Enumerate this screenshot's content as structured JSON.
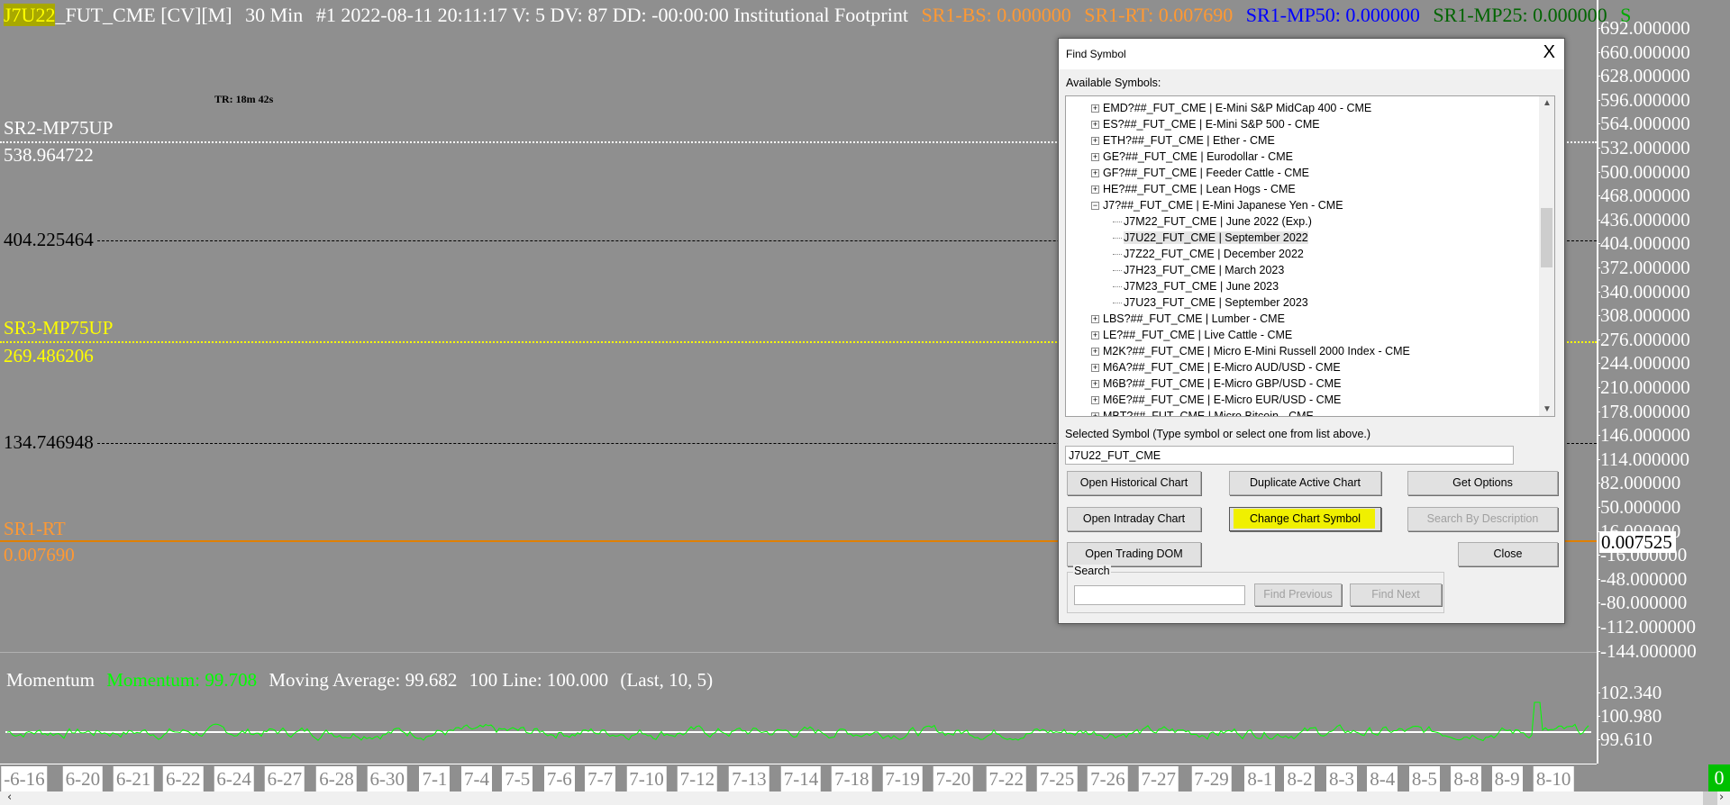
{
  "chart_header": {
    "symbol_highlight": "J7U22",
    "symbol_rest": "_FUT_CME [CV][M]",
    "interval": "30 Min",
    "info": "#1 2022-08-11 20:11:17 V: 5 DV: 87 DD: -00:00:00 Institutional Footprint",
    "sr1_bs": "SR1-BS: 0.000000",
    "sr1_rt": "SR1-RT: 0.007690",
    "sr1_mp50": "SR1-MP50: 0.000000",
    "sr1_mp25": "SR1-MP25: 0.000000",
    "trailing": "S"
  },
  "timer": "TR: 18m 42s",
  "levels": [
    {
      "name": "SR2-MP75UP",
      "value": "538.964722",
      "color": "#ffffff"
    },
    {
      "name": "",
      "value": "404.225464",
      "color": "#000000"
    },
    {
      "name": "SR3-MP75UP",
      "value": "269.486206",
      "color": "#ffff00"
    },
    {
      "name": "",
      "value": "134.746948",
      "color": "#000000"
    },
    {
      "name": "SR1-RT",
      "value": "0.007690",
      "color": "#ff8c32"
    }
  ],
  "price_axis": [
    "692.000000",
    "660.000000",
    "628.000000",
    "596.000000",
    "564.000000",
    "532.000000",
    "500.000000",
    "468.000000",
    "436.000000",
    "404.000000",
    "372.000000",
    "340.000000",
    "308.000000",
    "276.000000",
    "244.000000",
    "210.000000",
    "178.000000",
    "146.000000",
    "114.000000",
    "82.000000",
    "50.000000",
    "16.000000",
    "-16.000000",
    "-48.000000",
    "-80.000000",
    "-112.000000",
    "-144.000000"
  ],
  "current_price": "0.007525",
  "momentum": {
    "title": "Momentum",
    "value_label": "Momentum: 99.708",
    "ma_label": "Moving Average: 99.682",
    "line_label": "100 Line: 100.000",
    "params": "(Last, 10, 5)",
    "axis": [
      "102.340",
      "100.980",
      "99.610"
    ],
    "color": "#00ff00"
  },
  "dates": [
    "-6-16",
    "6-20",
    "6-21",
    "6-22",
    "6-24",
    "6-27",
    "6-28",
    "6-30",
    "7-1",
    "7-4",
    "7-5",
    "7-6",
    "7-7",
    "7-10",
    "7-12",
    "7-13",
    "7-14",
    "7-18",
    "7-19",
    "7-20",
    "7-22",
    "7-25",
    "7-26",
    "7-27",
    "7-29",
    "8-1",
    "8-2",
    "8-3",
    "8-4",
    "8-5",
    "8-8",
    "8-9",
    "8-10"
  ],
  "zero_badge": "0",
  "dialog": {
    "title": "Find Symbol",
    "close": "X",
    "available_label": "Available Symbols:",
    "symbols": [
      {
        "text": "EMD?##_FUT_CME  |  E-Mini S&P MidCap 400 - CME",
        "level": 0,
        "exp": "+"
      },
      {
        "text": "ES?##_FUT_CME  |  E-Mini S&P 500 - CME",
        "level": 0,
        "exp": "+"
      },
      {
        "text": "ETH?##_FUT_CME  |  Ether - CME",
        "level": 0,
        "exp": "+"
      },
      {
        "text": "GE?##_FUT_CME  |  Eurodollar - CME",
        "level": 0,
        "exp": "+"
      },
      {
        "text": "GF?##_FUT_CME  |  Feeder Cattle - CME",
        "level": 0,
        "exp": "+"
      },
      {
        "text": "HE?##_FUT_CME  |  Lean Hogs - CME",
        "level": 0,
        "exp": "+"
      },
      {
        "text": "J7?##_FUT_CME  |  E-Mini Japanese Yen - CME",
        "level": 0,
        "exp": "−"
      },
      {
        "text": "J7M22_FUT_CME  |  June 2022 (Exp.)",
        "level": 1,
        "exp": ""
      },
      {
        "text": "J7U22_FUT_CME  |  September 2022",
        "level": 1,
        "exp": "",
        "selected": true
      },
      {
        "text": "J7Z22_FUT_CME  |  December 2022",
        "level": 1,
        "exp": ""
      },
      {
        "text": "J7H23_FUT_CME  |  March 2023",
        "level": 1,
        "exp": ""
      },
      {
        "text": "J7M23_FUT_CME  |  June 2023",
        "level": 1,
        "exp": ""
      },
      {
        "text": "J7U23_FUT_CME  |  September 2023",
        "level": 1,
        "exp": ""
      },
      {
        "text": "LBS?##_FUT_CME  |  Lumber - CME",
        "level": 0,
        "exp": "+"
      },
      {
        "text": "LE?##_FUT_CME  |  Live Cattle - CME",
        "level": 0,
        "exp": "+"
      },
      {
        "text": "M2K?##_FUT_CME  |  Micro E-Mini Russell 2000 Index - CME",
        "level": 0,
        "exp": "+"
      },
      {
        "text": "M6A?##_FUT_CME  |  E-Micro AUD/USD - CME",
        "level": 0,
        "exp": "+"
      },
      {
        "text": "M6B?##_FUT_CME  |  E-Micro GBP/USD - CME",
        "level": 0,
        "exp": "+"
      },
      {
        "text": "M6E?##_FUT_CME  |  E-Micro EUR/USD - CME",
        "level": 0,
        "exp": "+"
      },
      {
        "text": "MBT?##_FUT_CME  |  Micro Bitcoin - CME",
        "level": 0,
        "exp": "+"
      }
    ],
    "selected_label": "Selected Symbol (Type symbol or select one from list above.)",
    "selected_value": "J7U22_FUT_CME",
    "buttons": {
      "open_historical": "Open Historical Chart",
      "duplicate": "Duplicate Active Chart",
      "get_options": "Get Options",
      "open_intraday": "Open Intraday Chart",
      "change_symbol": "Change Chart Symbol",
      "search_desc": "Search By Description",
      "open_dom": "Open Trading DOM",
      "close": "Close",
      "find_prev": "Find Previous",
      "find_next": "Find Next"
    },
    "search_label": "Search",
    "search_value": ""
  }
}
